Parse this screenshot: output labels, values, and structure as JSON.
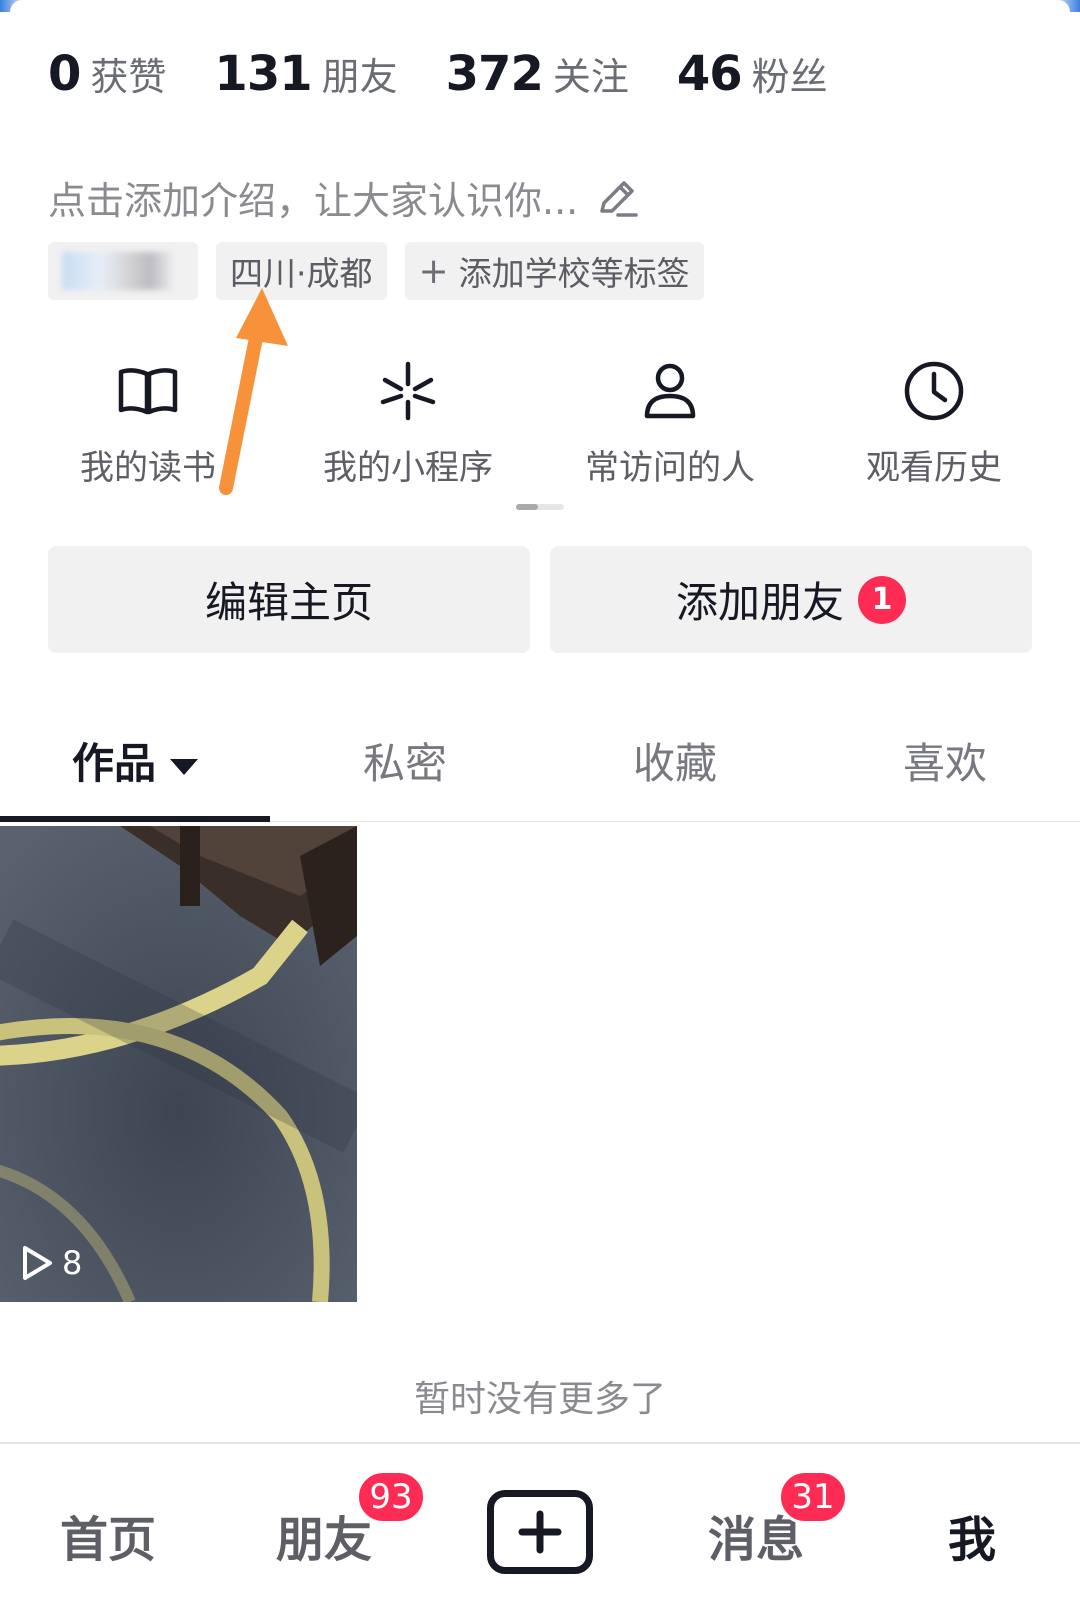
{
  "stats": [
    {
      "num": "0",
      "label": "获赞"
    },
    {
      "num": "131",
      "label": "朋友"
    },
    {
      "num": "372",
      "label": "关注"
    },
    {
      "num": "46",
      "label": "粉丝"
    }
  ],
  "intro": "点击添加介绍，让大家认识你...",
  "tags": {
    "location": "四川·成都",
    "add_tag": "添加学校等标签"
  },
  "shortcuts": [
    {
      "icon": "book-icon",
      "label": "我的读书"
    },
    {
      "icon": "mini-program-icon",
      "label": "我的小程序"
    },
    {
      "icon": "person-icon",
      "label": "常访问的人"
    },
    {
      "icon": "clock-icon",
      "label": "观看历史"
    }
  ],
  "buttons": {
    "edit": "编辑主页",
    "add_friends": "添加朋友",
    "add_friends_badge": "1"
  },
  "tabs": [
    {
      "label": "作品",
      "active": true
    },
    {
      "label": "私密"
    },
    {
      "label": "收藏"
    },
    {
      "label": "喜欢"
    }
  ],
  "videos": [
    {
      "plays": "8"
    }
  ],
  "no_more": "暂时没有更多了",
  "bottom_nav": {
    "home": "首页",
    "friends": "朋友",
    "friends_badge": "93",
    "messages": "消息",
    "messages_badge": "31",
    "me": "我"
  },
  "colors": {
    "accent": "#fe2c55",
    "annotation_arrow": "#f7923a",
    "text_primary": "#161823",
    "button_bg": "#f1f1f2"
  }
}
